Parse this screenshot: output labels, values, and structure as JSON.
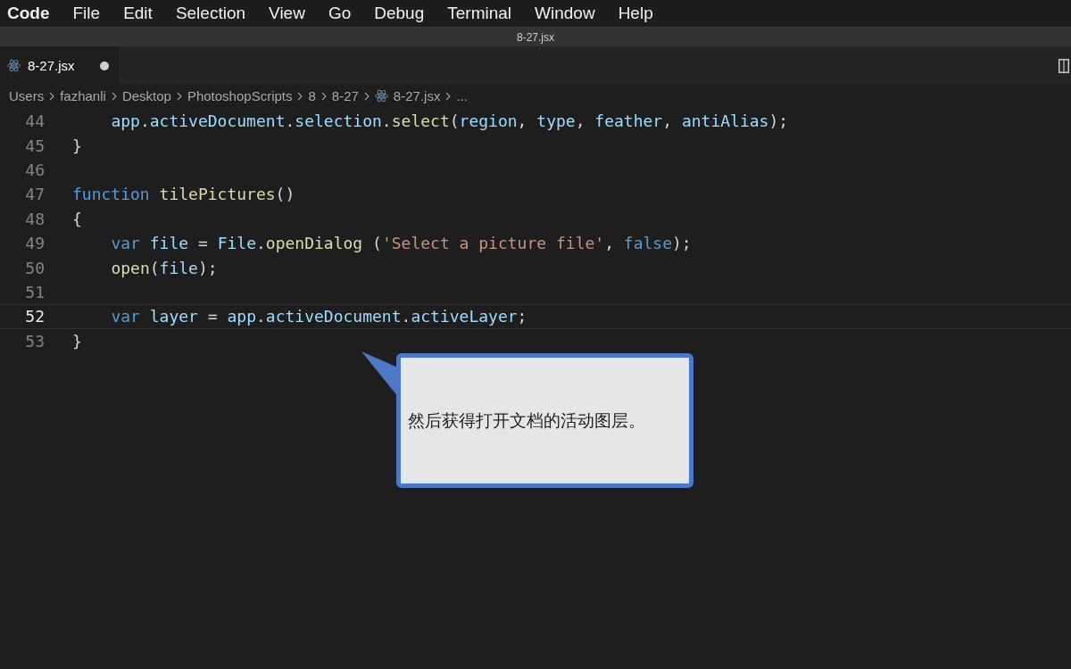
{
  "menu_bar": [
    {
      "label": "Code",
      "kind": "app"
    },
    {
      "label": "File",
      "kind": "menu"
    },
    {
      "label": "Edit",
      "kind": "menu"
    },
    {
      "label": "Selection",
      "kind": "menu"
    },
    {
      "label": "View",
      "kind": "menu"
    },
    {
      "label": "Go",
      "kind": "menu"
    },
    {
      "label": "Debug",
      "kind": "menu"
    },
    {
      "label": "Terminal",
      "kind": "menu"
    },
    {
      "label": "Window",
      "kind": "menu"
    },
    {
      "label": "Help",
      "kind": "menu"
    }
  ],
  "window": {
    "title": "8-27.jsx"
  },
  "tabs": [
    {
      "label": "8-27.jsx",
      "selected": true,
      "modified": true
    }
  ],
  "breadcrumbs": [
    {
      "label": "Users",
      "kind": "text"
    },
    {
      "label": "fazhanli",
      "kind": "text"
    },
    {
      "label": "Desktop",
      "kind": "text"
    },
    {
      "label": "PhotoshopScripts",
      "kind": "text"
    },
    {
      "label": "8",
      "kind": "text"
    },
    {
      "label": "8-27",
      "kind": "text"
    },
    {
      "label": "8-27.jsx",
      "kind": "file"
    },
    {
      "label": "...",
      "kind": "text"
    }
  ],
  "editor": {
    "lines": [
      {
        "number": "44",
        "indented": true,
        "current": false,
        "tokens": [
          {
            "text": "app",
            "kind": "var"
          },
          {
            "text": ".",
            "kind": "plain"
          },
          {
            "text": "activeDocument",
            "kind": "var"
          },
          {
            "text": ".",
            "kind": "plain"
          },
          {
            "text": "selection",
            "kind": "var"
          },
          {
            "text": ".",
            "kind": "plain"
          },
          {
            "text": "select",
            "kind": "fn"
          },
          {
            "text": "(",
            "kind": "plain"
          },
          {
            "text": "region",
            "kind": "var"
          },
          {
            "text": ", ",
            "kind": "plain"
          },
          {
            "text": "type",
            "kind": "var"
          },
          {
            "text": ", ",
            "kind": "plain"
          },
          {
            "text": "feather",
            "kind": "var"
          },
          {
            "text": ", ",
            "kind": "plain"
          },
          {
            "text": "antiAlias",
            "kind": "var"
          },
          {
            "text": ");",
            "kind": "plain"
          }
        ]
      },
      {
        "number": "45",
        "indented": false,
        "current": false,
        "tokens": [
          {
            "text": "}",
            "kind": "plain"
          }
        ]
      },
      {
        "number": "46",
        "current": false
      },
      {
        "number": "47",
        "indented": false,
        "current": false,
        "tokens": [
          {
            "text": "function ",
            "kind": "keyword"
          },
          {
            "text": "tilePictures",
            "kind": "fn"
          },
          {
            "text": "()",
            "kind": "plain"
          }
        ]
      },
      {
        "number": "48",
        "indented": false,
        "current": false,
        "tokens": [
          {
            "text": "{",
            "kind": "plain"
          }
        ]
      },
      {
        "number": "49",
        "indented": true,
        "current": false,
        "tokens": [
          {
            "text": "var ",
            "kind": "keyword"
          },
          {
            "text": "file",
            "kind": "var"
          },
          {
            "text": " = ",
            "kind": "plain"
          },
          {
            "text": "File",
            "kind": "var"
          },
          {
            "text": ".",
            "kind": "plain"
          },
          {
            "text": "openDialog",
            "kind": "fn"
          },
          {
            "text": " (",
            "kind": "plain"
          },
          {
            "text": "'Select a picture file'",
            "kind": "string"
          },
          {
            "text": ", ",
            "kind": "plain"
          },
          {
            "text": "false",
            "kind": "keyword"
          },
          {
            "text": ");",
            "kind": "plain"
          }
        ]
      },
      {
        "number": "50",
        "indented": true,
        "current": false,
        "tokens": [
          {
            "text": "open",
            "kind": "fn"
          },
          {
            "text": "(",
            "kind": "plain"
          },
          {
            "text": "file",
            "kind": "var"
          },
          {
            "text": ");",
            "kind": "plain"
          }
        ]
      },
      {
        "number": "51",
        "current": false
      },
      {
        "number": "52",
        "indented": true,
        "current": true,
        "tokens": [
          {
            "text": "var ",
            "kind": "keyword"
          },
          {
            "text": "layer",
            "kind": "var"
          },
          {
            "text": " = ",
            "kind": "plain"
          },
          {
            "text": "app",
            "kind": "var"
          },
          {
            "text": ".",
            "kind": "plain"
          },
          {
            "text": "activeDocument",
            "kind": "var"
          },
          {
            "text": ".",
            "kind": "plain"
          },
          {
            "text": "activeLayer",
            "kind": "var"
          },
          {
            "text": ";",
            "kind": "plain"
          }
        ]
      },
      {
        "number": "53",
        "indented": false,
        "current": false,
        "tokens": [
          {
            "text": "}",
            "kind": "plain"
          }
        ]
      }
    ]
  },
  "callout": {
    "text": "然后获得打开文档的活动图层。"
  }
}
